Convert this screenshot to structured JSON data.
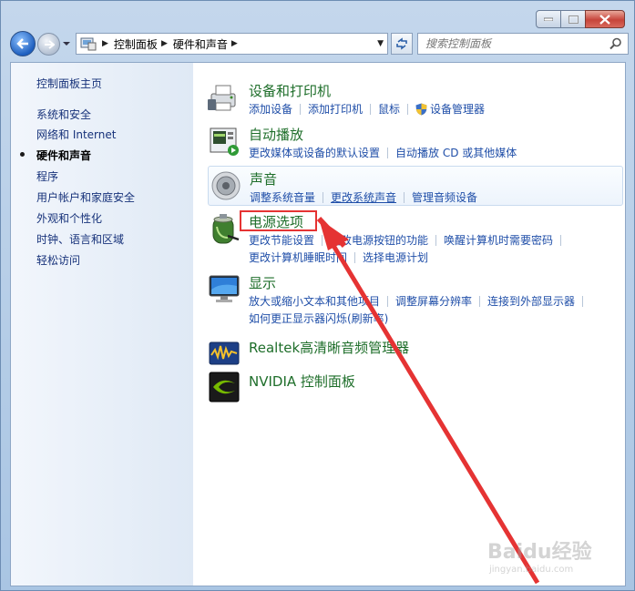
{
  "address": {
    "crumbs": [
      "控制面板",
      "硬件和声音"
    ]
  },
  "search": {
    "placeholder": "搜索控制面板"
  },
  "sidebar": {
    "items": [
      {
        "label": "控制面板主页"
      },
      {
        "label": "系统和安全"
      },
      {
        "label": "网络和 Internet"
      },
      {
        "label": "硬件和声音",
        "active": true
      },
      {
        "label": "程序"
      },
      {
        "label": "用户帐户和家庭安全"
      },
      {
        "label": "外观和个性化"
      },
      {
        "label": "时钟、语言和区域"
      },
      {
        "label": "轻松访问"
      }
    ]
  },
  "categories": {
    "devices": {
      "title": "设备和打印机",
      "links": [
        "添加设备",
        "添加打印机",
        "鼠标",
        "设备管理器"
      ]
    },
    "autoplay": {
      "title": "自动播放",
      "links": [
        "更改媒体或设备的默认设置",
        "自动播放 CD 或其他媒体"
      ]
    },
    "sound": {
      "title": "声音",
      "links": [
        "调整系统音量",
        "更改系统声音",
        "管理音频设备"
      ]
    },
    "power": {
      "title": "电源选项",
      "links_row1": [
        "更改节能设置",
        "更改电源按钮的功能",
        "唤醒计算机时需要密码"
      ],
      "links_row2": [
        "更改计算机睡眠时间",
        "选择电源计划"
      ]
    },
    "display": {
      "title": "显示",
      "links_row1": [
        "放大或缩小文本和其他项目",
        "调整屏幕分辨率",
        "连接到外部显示器"
      ],
      "links_row2": [
        "如何更正显示器闪烁(刷新率)"
      ]
    },
    "realtek": {
      "title": "Realtek高清晰音频管理器"
    },
    "nvidia": {
      "title": "NVIDIA 控制面板"
    }
  },
  "watermark": {
    "brand": "Baidu经验",
    "site": "jingyan.baidu.com"
  },
  "colors": {
    "title_green": "#1e6e2a",
    "link_blue": "#1f4ea8",
    "annotation_red": "#e53333"
  }
}
